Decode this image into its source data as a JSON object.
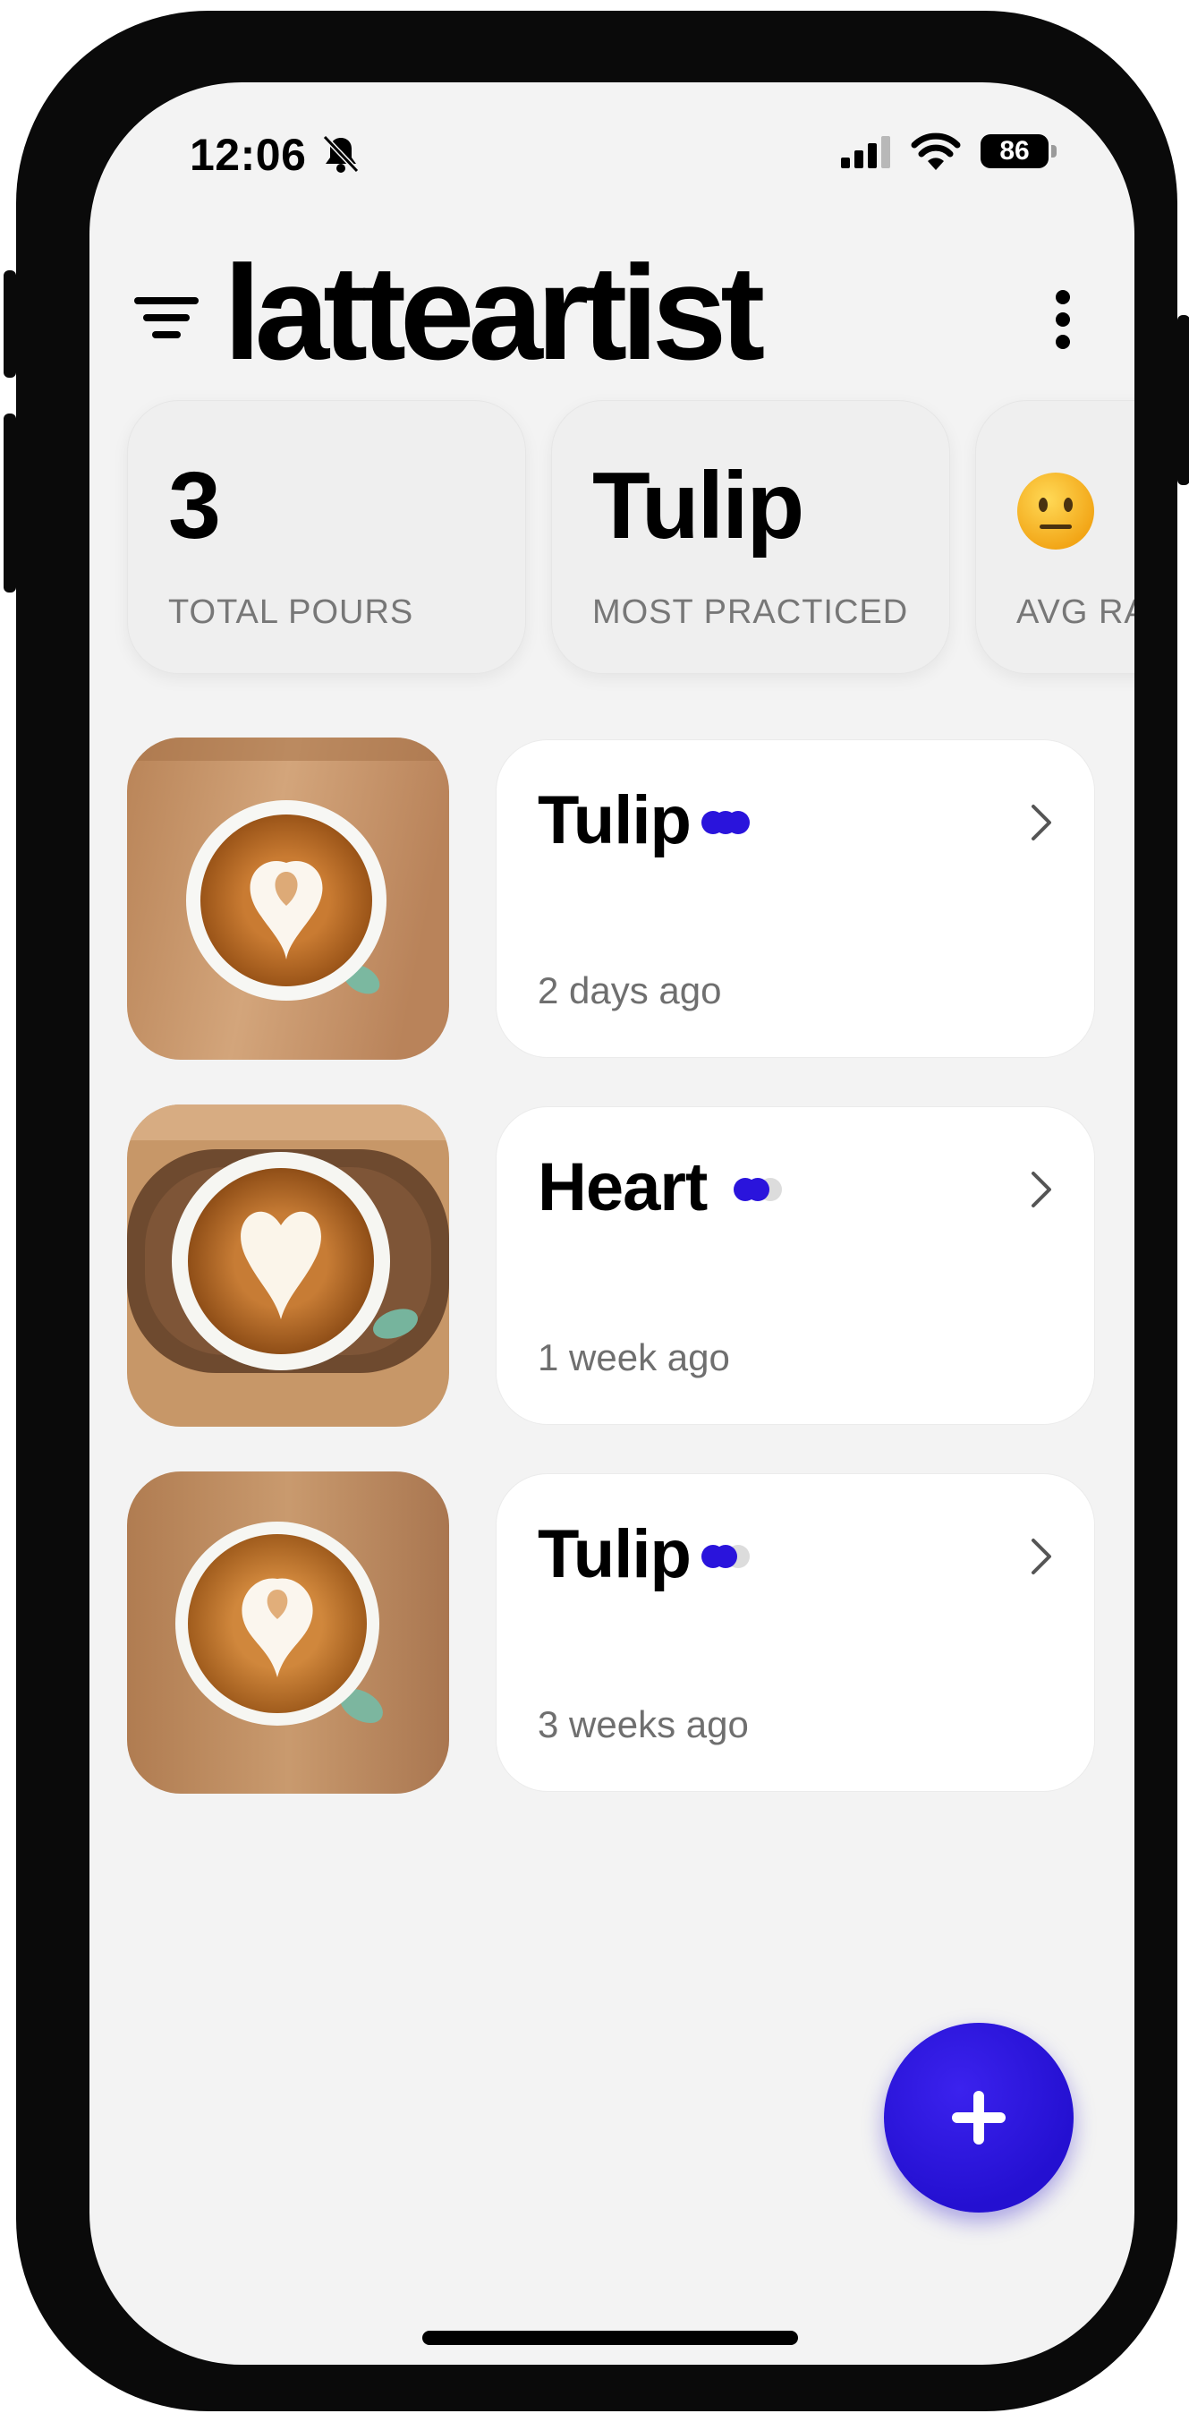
{
  "status_bar": {
    "time": "12:06",
    "battery": "86",
    "icons": [
      "bell-slash-icon",
      "signal-icon",
      "wifi-icon",
      "battery-icon"
    ]
  },
  "header": {
    "title": "latteartist",
    "icons": [
      "menu-filter-icon",
      "more-vertical-icon"
    ]
  },
  "stats": [
    {
      "value": "3",
      "label": "TOTAL POURS"
    },
    {
      "value": "Tulip",
      "label": "MOST PRACTICED"
    },
    {
      "emoji": "neutral-face-icon",
      "label": "AVG RA"
    }
  ],
  "pours": [
    {
      "name": "Tulip",
      "time": "2 days ago",
      "rating_filled": 3,
      "rating_total": 3
    },
    {
      "name": "Heart",
      "time": "1 week ago",
      "rating_filled": 2,
      "rating_total": 3
    },
    {
      "name": "Tulip",
      "time": "3 weeks ago",
      "rating_filled": 2,
      "rating_total": 3
    }
  ],
  "fab": {
    "icon": "plus-icon"
  },
  "colors": {
    "accent": "#2a14dc",
    "background": "#f3f3f3",
    "card": "#ffffff",
    "muted_text": "#6f6f6f"
  }
}
